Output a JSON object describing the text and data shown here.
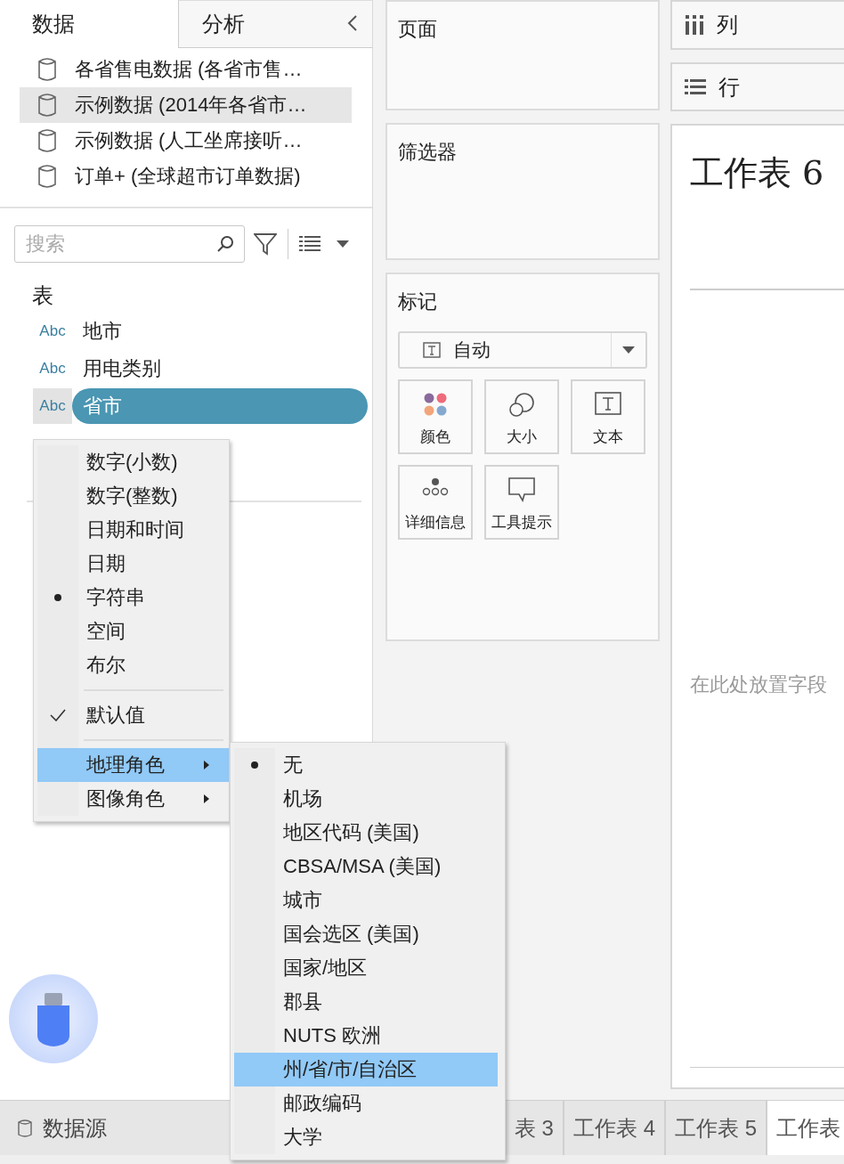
{
  "left_panel": {
    "tabs": [
      {
        "label": "数据",
        "selected": true
      },
      {
        "label": "分析",
        "selected": false
      }
    ],
    "data_sources": [
      {
        "name": "各省售电数据 (各省市售…",
        "selected": false
      },
      {
        "name": "示例数据 (2014年各省市…",
        "selected": true
      },
      {
        "name": "示例数据 (人工坐席接听…",
        "selected": false
      },
      {
        "name": "订单+ (全球超市订单数据)",
        "selected": false
      }
    ],
    "search": {
      "placeholder": "搜索"
    },
    "tables_heading": "表",
    "fields": [
      {
        "type": "Abc",
        "name": "地市",
        "selected": false
      },
      {
        "type": "Abc",
        "name": "用电类别",
        "selected": false
      },
      {
        "type": "Abc",
        "name": "省市",
        "selected": true
      }
    ]
  },
  "context_menu": {
    "groups": [
      [
        {
          "label": "数字(小数)",
          "kind": "radio",
          "checked": false,
          "selected": false
        },
        {
          "label": "数字(整数)",
          "kind": "radio",
          "checked": false,
          "selected": false
        },
        {
          "label": "日期和时间",
          "kind": "radio",
          "checked": false,
          "selected": false
        },
        {
          "label": "日期",
          "kind": "radio",
          "checked": false,
          "selected": false
        },
        {
          "label": "字符串",
          "kind": "radio",
          "checked": true,
          "selected": false
        },
        {
          "label": "空间",
          "kind": "radio",
          "checked": false,
          "selected": false
        },
        {
          "label": "布尔",
          "kind": "radio",
          "checked": false,
          "selected": false
        }
      ],
      [
        {
          "label": "默认值",
          "kind": "check",
          "checked": true,
          "selected": false
        }
      ],
      [
        {
          "label": "地理角色",
          "kind": "submenu",
          "checked": false,
          "selected": true
        },
        {
          "label": "图像角色",
          "kind": "submenu",
          "checked": false,
          "selected": false
        }
      ]
    ]
  },
  "submenu": {
    "items": [
      {
        "label": "无",
        "checked": true,
        "selected": false
      },
      {
        "label": "机场",
        "checked": false,
        "selected": false
      },
      {
        "label": "地区代码 (美国)",
        "checked": false,
        "selected": false
      },
      {
        "label": "CBSA/MSA (美国)",
        "checked": false,
        "selected": false
      },
      {
        "label": "城市",
        "checked": false,
        "selected": false
      },
      {
        "label": "国会选区 (美国)",
        "checked": false,
        "selected": false
      },
      {
        "label": "国家/地区",
        "checked": false,
        "selected": false
      },
      {
        "label": "郡县",
        "checked": false,
        "selected": false
      },
      {
        "label": "NUTS 欧洲",
        "checked": false,
        "selected": false
      },
      {
        "label": "州/省/市/自治区",
        "checked": false,
        "selected": true
      },
      {
        "label": "邮政编码",
        "checked": false,
        "selected": false
      },
      {
        "label": "大学",
        "checked": false,
        "selected": false
      }
    ]
  },
  "shelves": {
    "pages": "页面",
    "filters": "筛选器",
    "columns": "列",
    "rows": "行"
  },
  "marks": {
    "title": "标记",
    "mark_type": "自动",
    "buttons": [
      {
        "label": "颜色",
        "kind": "color"
      },
      {
        "label": "大小",
        "kind": "size"
      },
      {
        "label": "文本",
        "kind": "text"
      },
      {
        "label": "详细信息",
        "kind": "detail"
      },
      {
        "label": "工具提示",
        "kind": "tooltip"
      }
    ]
  },
  "worksheet": {
    "title": "工作表 6",
    "drop_hint": "在此处放置字段"
  },
  "bottom_bar": {
    "data_source": "数据源",
    "tabs": [
      {
        "label": "表 3",
        "selected": false
      },
      {
        "label": "工作表 4",
        "selected": false
      },
      {
        "label": "工作表 5",
        "selected": false
      },
      {
        "label": "工作表",
        "selected": true
      }
    ]
  }
}
